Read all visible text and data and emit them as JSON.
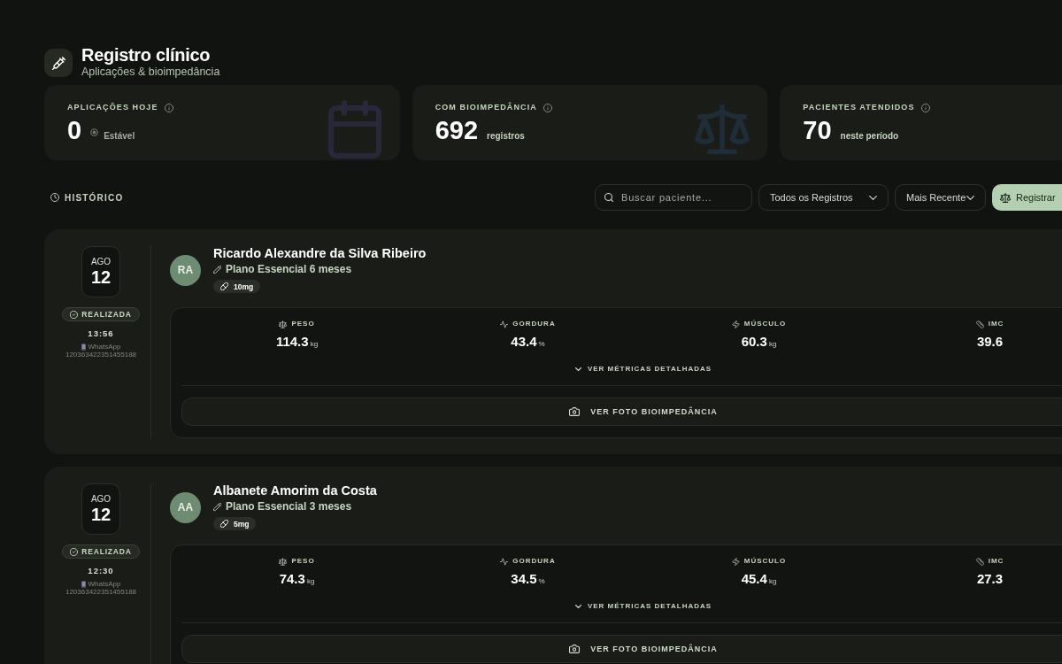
{
  "header": {
    "title": "Registro clínico",
    "subtitle": "Aplicações & bioimpedância"
  },
  "stats": [
    {
      "label": "APLICAÇÕES HOJE",
      "value": "0",
      "note": "Estável",
      "kind": "status"
    },
    {
      "label": "COM BIOIMPEDÂNCIA",
      "value": "692",
      "note": "registros",
      "kind": "count"
    },
    {
      "label": "PACIENTES ATENDIDOS",
      "value": "70",
      "note": "neste período",
      "kind": "count"
    }
  ],
  "toolbar": {
    "section": "HISTÓRICO",
    "search": {
      "placeholder": "Buscar paciente..."
    },
    "filters": [
      "Todos os Registros",
      "Mais Recente"
    ],
    "primary_button": "Registrar"
  },
  "records": [
    {
      "month": "AGO",
      "day": "12",
      "status": "REALIZADA",
      "time": "13:56",
      "source": "WhatsApp",
      "source_id": "120363422351455188",
      "initials": "RA",
      "name": "Ricardo Alexandre da Silva Ribeiro",
      "plan": "Plano Essencial 6 meses",
      "dose": "10mg",
      "metrics": [
        {
          "label": "PESO",
          "value": "114.3",
          "unit": "kg"
        },
        {
          "label": "GORDURA",
          "value": "43.4",
          "unit": "%"
        },
        {
          "label": "MÚSCULO",
          "value": "60.3",
          "unit": "kg"
        },
        {
          "label": "IMC",
          "value": "39.6"
        }
      ],
      "details_link": "VER MÉTRICAS DETALHADAS",
      "metrics_expanded": false,
      "photo_button": "VER FOTO BIOIMPEDÂNCIA"
    },
    {
      "month": "AGO",
      "day": "12",
      "status": "REALIZADA",
      "time": "12:30",
      "source": "WhatsApp",
      "source_id": "120363422351455188",
      "initials": "AA",
      "name": "Albanete Amorim da Costa",
      "plan": "Plano Essencial 3 meses",
      "dose": "5mg",
      "metrics": [
        {
          "label": "PESO",
          "value": "74.3",
          "unit": "kg"
        },
        {
          "label": "GORDURA",
          "value": "34.5",
          "unit": "%"
        },
        {
          "label": "MÚSCULO",
          "value": "45.4",
          "unit": "kg"
        },
        {
          "label": "IMC",
          "value": "27.3"
        }
      ],
      "details_link": "VER MÉTRICAS DETALHADAS",
      "metrics_expanded": false,
      "photo_button": "VER FOTO BIOIMPEDÂNCIA"
    }
  ]
}
